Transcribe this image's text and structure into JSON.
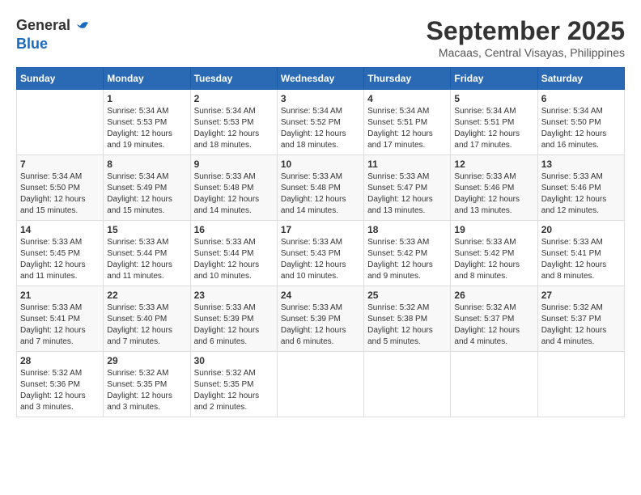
{
  "header": {
    "logo_line1": "General",
    "logo_line2": "Blue",
    "month": "September 2025",
    "location": "Macaas, Central Visayas, Philippines"
  },
  "weekdays": [
    "Sunday",
    "Monday",
    "Tuesday",
    "Wednesday",
    "Thursday",
    "Friday",
    "Saturday"
  ],
  "weeks": [
    [
      {
        "day": "",
        "info": ""
      },
      {
        "day": "1",
        "info": "Sunrise: 5:34 AM\nSunset: 5:53 PM\nDaylight: 12 hours\nand 19 minutes."
      },
      {
        "day": "2",
        "info": "Sunrise: 5:34 AM\nSunset: 5:53 PM\nDaylight: 12 hours\nand 18 minutes."
      },
      {
        "day": "3",
        "info": "Sunrise: 5:34 AM\nSunset: 5:52 PM\nDaylight: 12 hours\nand 18 minutes."
      },
      {
        "day": "4",
        "info": "Sunrise: 5:34 AM\nSunset: 5:51 PM\nDaylight: 12 hours\nand 17 minutes."
      },
      {
        "day": "5",
        "info": "Sunrise: 5:34 AM\nSunset: 5:51 PM\nDaylight: 12 hours\nand 17 minutes."
      },
      {
        "day": "6",
        "info": "Sunrise: 5:34 AM\nSunset: 5:50 PM\nDaylight: 12 hours\nand 16 minutes."
      }
    ],
    [
      {
        "day": "7",
        "info": "Sunrise: 5:34 AM\nSunset: 5:50 PM\nDaylight: 12 hours\nand 15 minutes."
      },
      {
        "day": "8",
        "info": "Sunrise: 5:34 AM\nSunset: 5:49 PM\nDaylight: 12 hours\nand 15 minutes."
      },
      {
        "day": "9",
        "info": "Sunrise: 5:33 AM\nSunset: 5:48 PM\nDaylight: 12 hours\nand 14 minutes."
      },
      {
        "day": "10",
        "info": "Sunrise: 5:33 AM\nSunset: 5:48 PM\nDaylight: 12 hours\nand 14 minutes."
      },
      {
        "day": "11",
        "info": "Sunrise: 5:33 AM\nSunset: 5:47 PM\nDaylight: 12 hours\nand 13 minutes."
      },
      {
        "day": "12",
        "info": "Sunrise: 5:33 AM\nSunset: 5:46 PM\nDaylight: 12 hours\nand 13 minutes."
      },
      {
        "day": "13",
        "info": "Sunrise: 5:33 AM\nSunset: 5:46 PM\nDaylight: 12 hours\nand 12 minutes."
      }
    ],
    [
      {
        "day": "14",
        "info": "Sunrise: 5:33 AM\nSunset: 5:45 PM\nDaylight: 12 hours\nand 11 minutes."
      },
      {
        "day": "15",
        "info": "Sunrise: 5:33 AM\nSunset: 5:44 PM\nDaylight: 12 hours\nand 11 minutes."
      },
      {
        "day": "16",
        "info": "Sunrise: 5:33 AM\nSunset: 5:44 PM\nDaylight: 12 hours\nand 10 minutes."
      },
      {
        "day": "17",
        "info": "Sunrise: 5:33 AM\nSunset: 5:43 PM\nDaylight: 12 hours\nand 10 minutes."
      },
      {
        "day": "18",
        "info": "Sunrise: 5:33 AM\nSunset: 5:42 PM\nDaylight: 12 hours\nand 9 minutes."
      },
      {
        "day": "19",
        "info": "Sunrise: 5:33 AM\nSunset: 5:42 PM\nDaylight: 12 hours\nand 8 minutes."
      },
      {
        "day": "20",
        "info": "Sunrise: 5:33 AM\nSunset: 5:41 PM\nDaylight: 12 hours\nand 8 minutes."
      }
    ],
    [
      {
        "day": "21",
        "info": "Sunrise: 5:33 AM\nSunset: 5:41 PM\nDaylight: 12 hours\nand 7 minutes."
      },
      {
        "day": "22",
        "info": "Sunrise: 5:33 AM\nSunset: 5:40 PM\nDaylight: 12 hours\nand 7 minutes."
      },
      {
        "day": "23",
        "info": "Sunrise: 5:33 AM\nSunset: 5:39 PM\nDaylight: 12 hours\nand 6 minutes."
      },
      {
        "day": "24",
        "info": "Sunrise: 5:33 AM\nSunset: 5:39 PM\nDaylight: 12 hours\nand 6 minutes."
      },
      {
        "day": "25",
        "info": "Sunrise: 5:32 AM\nSunset: 5:38 PM\nDaylight: 12 hours\nand 5 minutes."
      },
      {
        "day": "26",
        "info": "Sunrise: 5:32 AM\nSunset: 5:37 PM\nDaylight: 12 hours\nand 4 minutes."
      },
      {
        "day": "27",
        "info": "Sunrise: 5:32 AM\nSunset: 5:37 PM\nDaylight: 12 hours\nand 4 minutes."
      }
    ],
    [
      {
        "day": "28",
        "info": "Sunrise: 5:32 AM\nSunset: 5:36 PM\nDaylight: 12 hours\nand 3 minutes."
      },
      {
        "day": "29",
        "info": "Sunrise: 5:32 AM\nSunset: 5:35 PM\nDaylight: 12 hours\nand 3 minutes."
      },
      {
        "day": "30",
        "info": "Sunrise: 5:32 AM\nSunset: 5:35 PM\nDaylight: 12 hours\nand 2 minutes."
      },
      {
        "day": "",
        "info": ""
      },
      {
        "day": "",
        "info": ""
      },
      {
        "day": "",
        "info": ""
      },
      {
        "day": "",
        "info": ""
      }
    ]
  ]
}
